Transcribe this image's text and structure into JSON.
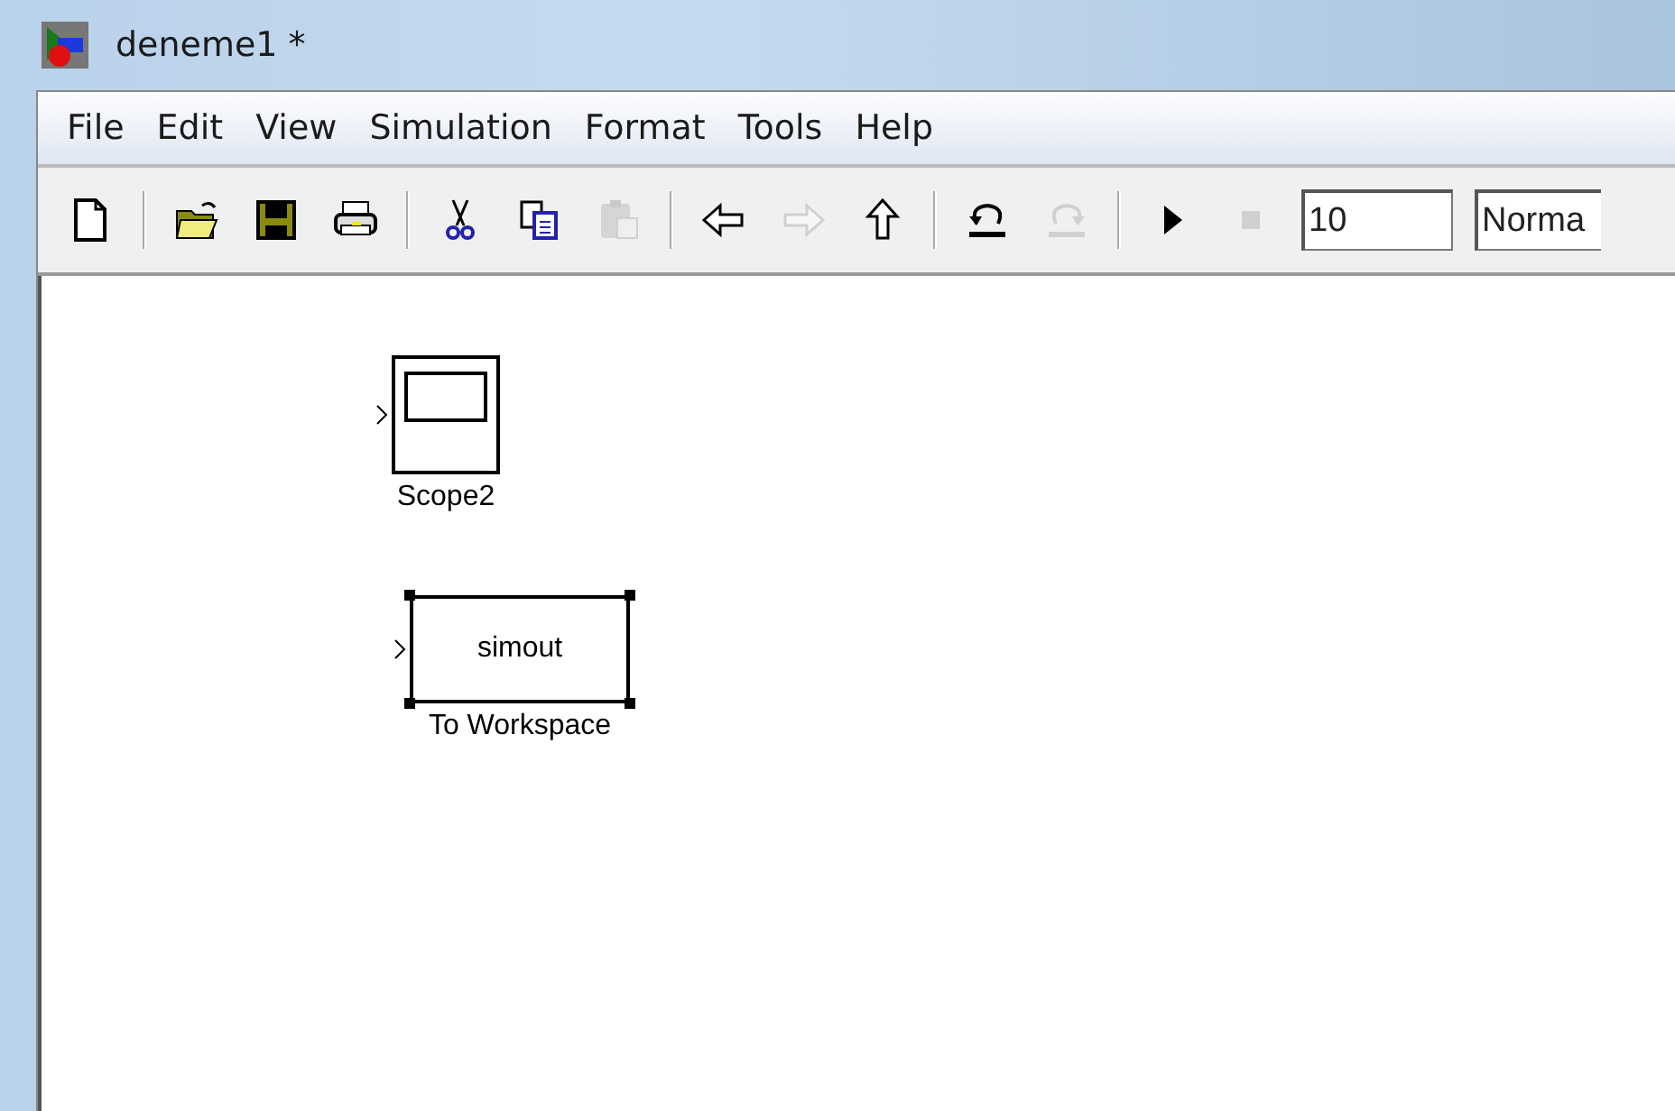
{
  "window": {
    "title": "deneme1 *"
  },
  "menu": [
    "File",
    "Edit",
    "View",
    "Simulation",
    "Format",
    "Tools",
    "Help"
  ],
  "toolbar": {
    "tools": [
      {
        "kind": "new",
        "disabled": false
      },
      {
        "kind": "separator"
      },
      {
        "kind": "open",
        "disabled": false
      },
      {
        "kind": "save",
        "disabled": false
      },
      {
        "kind": "print",
        "disabled": false
      },
      {
        "kind": "separator"
      },
      {
        "kind": "cut",
        "disabled": false
      },
      {
        "kind": "copy",
        "disabled": false
      },
      {
        "kind": "paste",
        "disabled": true
      },
      {
        "kind": "separator"
      },
      {
        "kind": "back",
        "disabled": false
      },
      {
        "kind": "forward",
        "disabled": true
      },
      {
        "kind": "up",
        "disabled": false
      },
      {
        "kind": "separator"
      },
      {
        "kind": "undo",
        "disabled": false
      },
      {
        "kind": "redo",
        "disabled": true
      },
      {
        "kind": "separator"
      },
      {
        "kind": "start",
        "disabled": false
      },
      {
        "kind": "stop",
        "disabled": true
      }
    ],
    "stop_time": "10",
    "mode": "Norma"
  },
  "blocks": [
    {
      "kind": "scope",
      "label": "Scope2",
      "selected": false
    },
    {
      "kind": "to_workspace",
      "label": "To Workspace",
      "variable": "simout",
      "selected": true
    }
  ]
}
